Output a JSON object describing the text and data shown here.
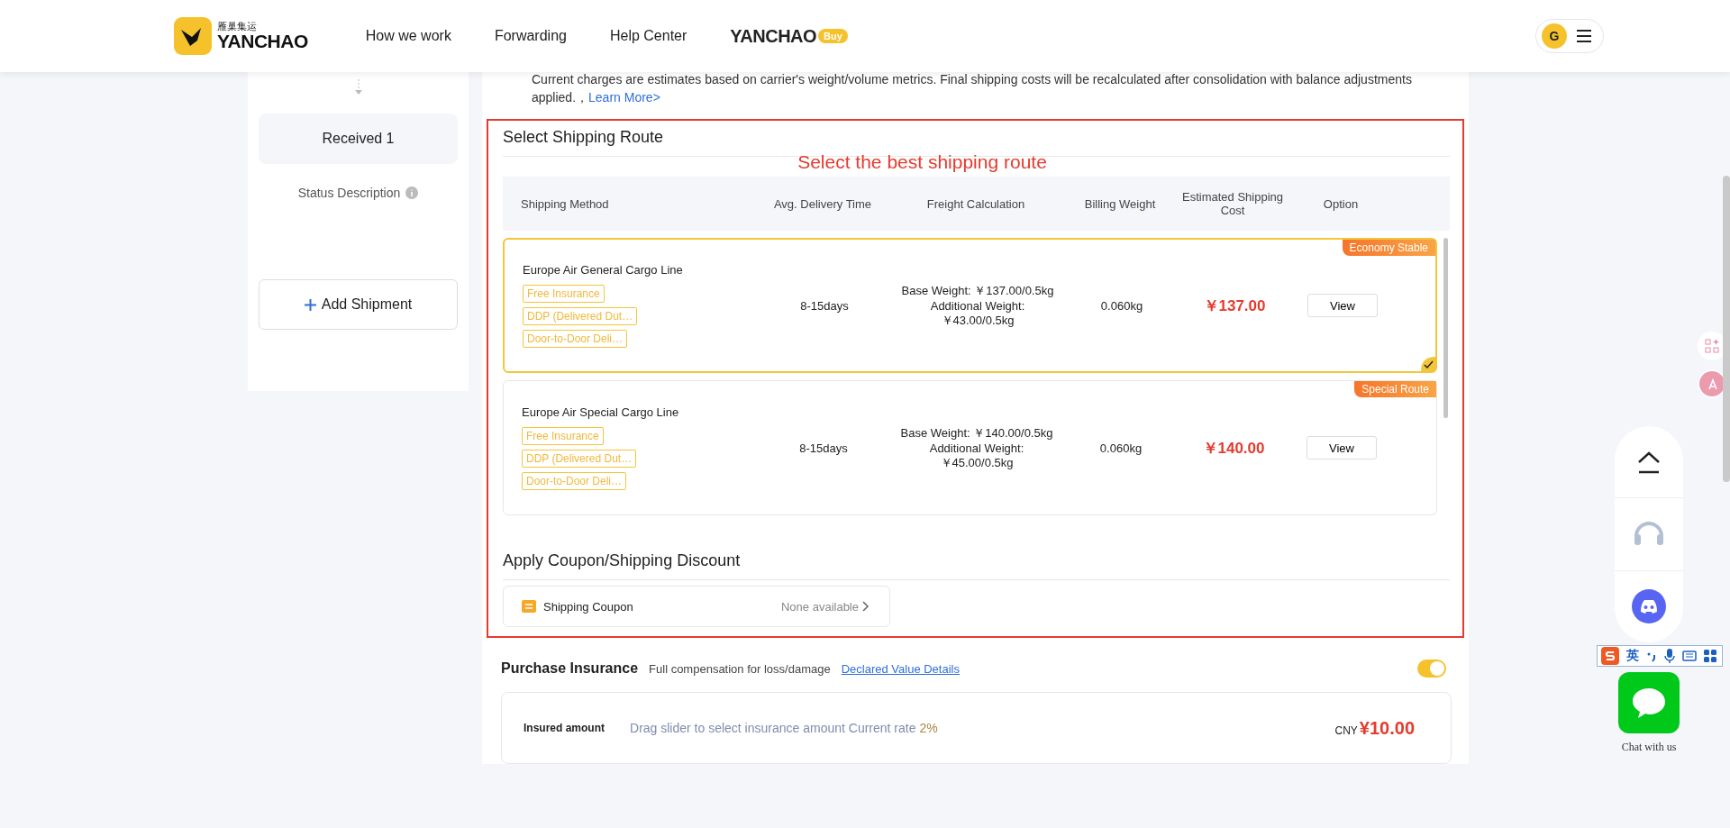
{
  "header": {
    "logo_subtitle": "雁巢集运",
    "logo_text": "YANCHAO",
    "nav": [
      {
        "label": "How we work"
      },
      {
        "label": "Forwarding"
      },
      {
        "label": "Help Center"
      }
    ],
    "brand": "YANCHAO",
    "brand_badge": "Buy",
    "avatar": "G"
  },
  "sidebar": {
    "step": "Received 1",
    "status": "Status Description",
    "add_button": "Add Shipment"
  },
  "notice": {
    "text": "Current charges are estimates based on carrier's weight/volume metrics. Final shipping costs will be recalculated after consolidation with balance adjustments applied.，",
    "link": "Learn More>"
  },
  "route_section": {
    "title": "Select Shipping Route",
    "annotation": "Select the best shipping route",
    "columns": [
      "Shipping Method",
      "Avg. Delivery Time",
      "Freight Calculation",
      "Billing Weight",
      "Estimated Shipping Cost",
      "Option"
    ],
    "routes": [
      {
        "name": "Europe Air General Cargo Line",
        "selected": true,
        "tag": "Economy Stable",
        "services": [
          "Free Insurance",
          "DDP (Delivered Dut…",
          "Door-to-Door Deli…"
        ],
        "time": "8-15days",
        "base": "Base Weight: ￥137.00/0.5kg",
        "additional_label": "Additional Weight:",
        "additional_value": "￥43.00/0.5kg",
        "weight": "0.060kg",
        "cost": "￥137.00",
        "action": "View"
      },
      {
        "name": "Europe Air Special Cargo Line",
        "selected": false,
        "tag": "Special Route",
        "services": [
          "Free Insurance",
          "DDP (Delivered Dut…",
          "Door-to-Door Deli…"
        ],
        "time": "8-15days",
        "base": "Base Weight: ￥140.00/0.5kg",
        "additional_label": "Additional Weight:",
        "additional_value": "￥45.00/0.5kg",
        "weight": "0.060kg",
        "cost": "￥140.00",
        "action": "View"
      }
    ]
  },
  "coupon": {
    "title": "Apply Coupon/Shipping Discount",
    "label": "Shipping Coupon",
    "value": "None available"
  },
  "insurance": {
    "title": "Purchase Insurance",
    "subtitle": "Full compensation for loss/damage",
    "link": "Declared Value Details",
    "on": true,
    "insured_label": "Insured amount",
    "hint": "Drag slider to select insurance amount Current rate",
    "rate": "2%",
    "currency": "CNY",
    "amount": "¥10.00"
  },
  "floating": {
    "chat_label": "Chat with us",
    "ime_label": "英"
  }
}
